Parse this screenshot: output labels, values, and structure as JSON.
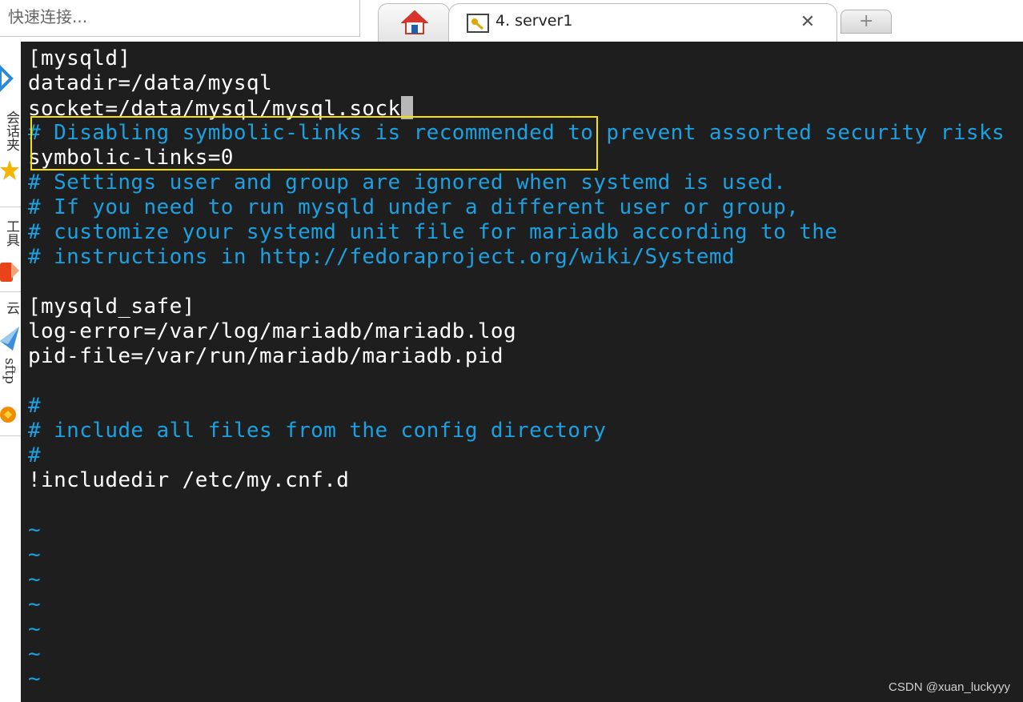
{
  "quick_connect": {
    "placeholder": "快速连接..."
  },
  "tabs": {
    "active_title": "4. server1",
    "close_glyph": "✕",
    "new_glyph": "+"
  },
  "left_strip": {
    "labels": [
      "会话夹",
      "工具",
      "云",
      "sftp"
    ]
  },
  "terminal": {
    "lines": [
      {
        "text": "[mysqld]",
        "kind": "normal"
      },
      {
        "text": "datadir=/data/mysql",
        "kind": "normal"
      },
      {
        "text": "socket=/data/mysql/mysql.sock",
        "kind": "normal",
        "cursor": true
      },
      {
        "text": "# Disabling symbolic-links is recommended to prevent assorted security risks",
        "kind": "comment"
      },
      {
        "text": "symbolic-links=0",
        "kind": "normal"
      },
      {
        "text": "# Settings user and group are ignored when systemd is used.",
        "kind": "comment"
      },
      {
        "text": "# If you need to run mysqld under a different user or group,",
        "kind": "comment"
      },
      {
        "text": "# customize your systemd unit file for mariadb according to the",
        "kind": "comment"
      },
      {
        "text": "# instructions in http://fedoraproject.org/wiki/Systemd",
        "kind": "comment"
      },
      {
        "text": "",
        "kind": "normal"
      },
      {
        "text": "[mysqld_safe]",
        "kind": "normal"
      },
      {
        "text": "log-error=/var/log/mariadb/mariadb.log",
        "kind": "normal"
      },
      {
        "text": "pid-file=/var/run/mariadb/mariadb.pid",
        "kind": "normal"
      },
      {
        "text": "",
        "kind": "normal"
      },
      {
        "text": "#",
        "kind": "comment"
      },
      {
        "text": "# include all files from the config directory",
        "kind": "comment"
      },
      {
        "text": "#",
        "kind": "comment"
      },
      {
        "text": "!includedir /etc/my.cnf.d",
        "kind": "normal"
      },
      {
        "text": "",
        "kind": "normal"
      },
      {
        "text": "~",
        "kind": "tilde"
      },
      {
        "text": "~",
        "kind": "tilde"
      },
      {
        "text": "~",
        "kind": "tilde"
      },
      {
        "text": "~",
        "kind": "tilde"
      },
      {
        "text": "~",
        "kind": "tilde"
      },
      {
        "text": "~",
        "kind": "tilde"
      },
      {
        "text": "~",
        "kind": "tilde"
      }
    ]
  },
  "watermark": "CSDN @xuan_luckyyy",
  "colors": {
    "terminal_bg": "#1e1e1e",
    "comment": "#1ba1e2",
    "highlight_box": "#f5e000"
  }
}
